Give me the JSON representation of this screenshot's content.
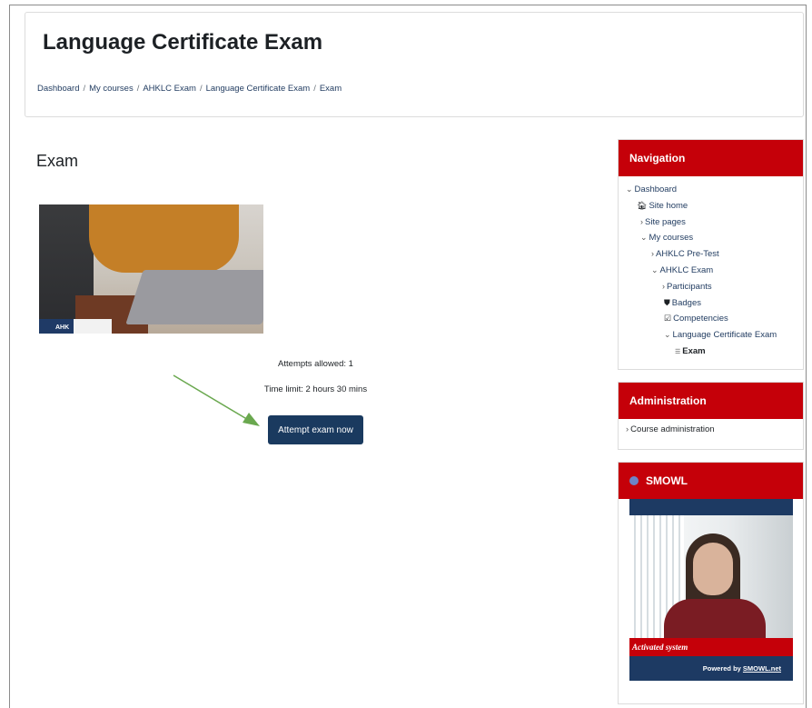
{
  "header": {
    "title": "Language Certificate Exam",
    "breadcrumb": [
      "Dashboard",
      "My courses",
      "AHKLC Exam",
      "Language Certificate Exam",
      "Exam"
    ],
    "breadcrumb_separator": "/"
  },
  "main": {
    "heading": "Exam",
    "image_logo_text": "AHK",
    "attempts_allowed": "Attempts allowed: 1",
    "time_limit": "Time limit: 2 hours 30 mins",
    "attempt_button": "Attempt exam now"
  },
  "navigation": {
    "title": "Navigation",
    "items": [
      {
        "label": "Dashboard",
        "caret": "⌄",
        "icon": ""
      },
      {
        "label": "Site home",
        "caret": "",
        "icon": "home-icon"
      },
      {
        "label": "Site pages",
        "caret": "›",
        "icon": ""
      },
      {
        "label": "My courses",
        "caret": "⌄",
        "icon": ""
      },
      {
        "label": "AHKLC Pre-Test",
        "caret": "›",
        "icon": ""
      },
      {
        "label": "AHKLC Exam",
        "caret": "⌄",
        "icon": ""
      },
      {
        "label": "Participants",
        "caret": "›",
        "icon": ""
      },
      {
        "label": "Badges",
        "caret": "",
        "icon": "shield-icon"
      },
      {
        "label": "Competencies",
        "caret": "",
        "icon": "checkbox-icon"
      },
      {
        "label": "Language Certificate Exam",
        "caret": "⌄",
        "icon": ""
      },
      {
        "label": "Exam",
        "caret": "",
        "icon": "list-icon"
      }
    ]
  },
  "administration": {
    "title": "Administration",
    "item": "Course administration"
  },
  "smowl": {
    "title": "SMOWL",
    "status": "Activated system",
    "footer_prefix": "Powered by ",
    "footer_link": "SMOWL.net"
  },
  "colors": {
    "brand_red": "#c50009",
    "button_navy": "#1a3a5f",
    "annotation_arrow": "#6aa84f"
  }
}
